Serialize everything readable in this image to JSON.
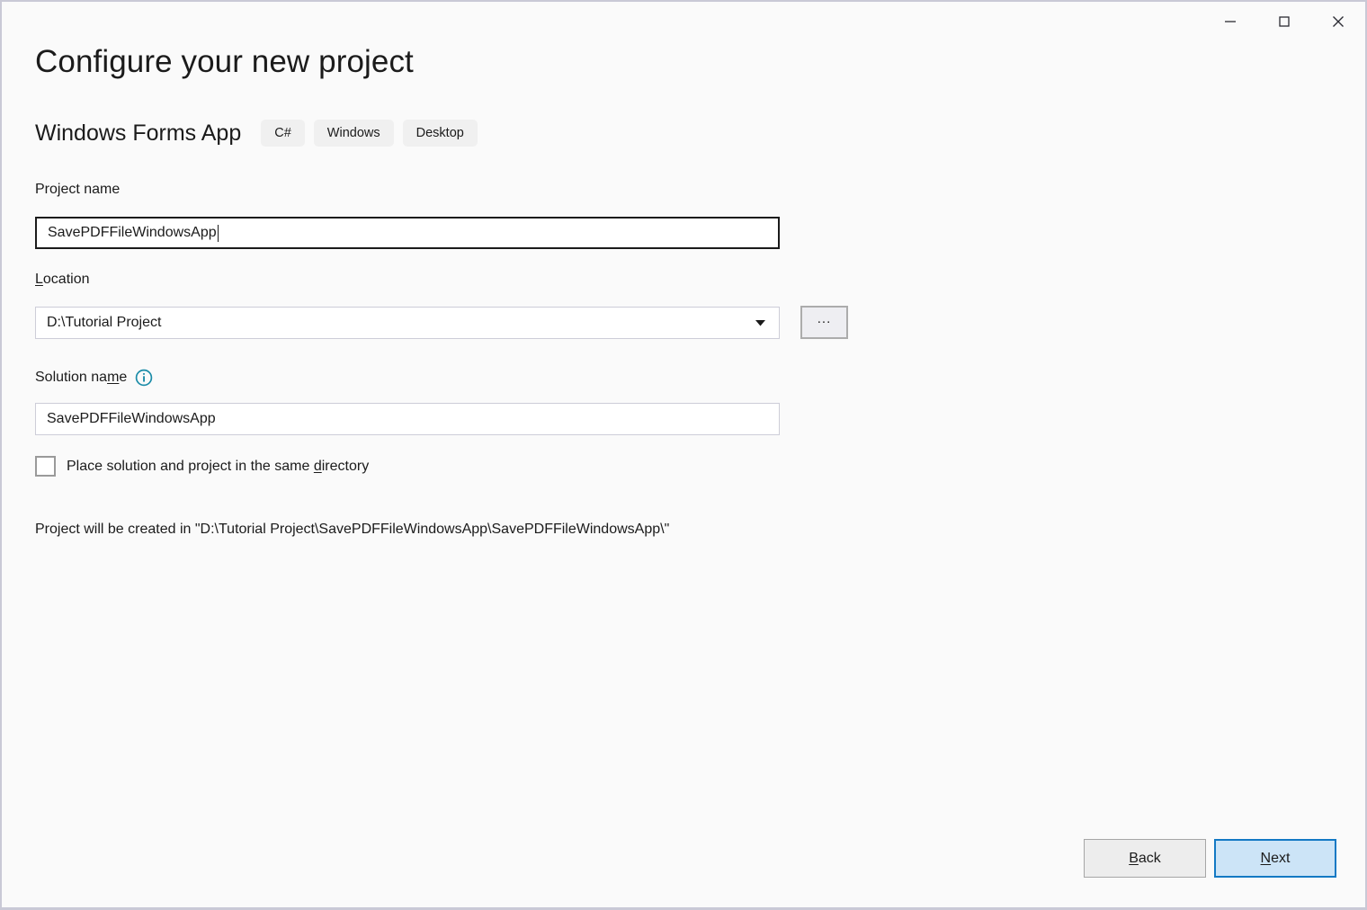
{
  "window": {
    "controls": [
      {
        "name": "minimize-button",
        "icon": "minimize-icon"
      },
      {
        "name": "maximize-button",
        "icon": "maximize-icon"
      },
      {
        "name": "close-button",
        "icon": "close-icon"
      }
    ]
  },
  "header": {
    "title": "Configure your new project",
    "template_name": "Windows Forms App",
    "tags": [
      "C#",
      "Windows",
      "Desktop"
    ]
  },
  "form": {
    "project_name": {
      "label": "Project name",
      "value": "SavePDFFileWindowsApp",
      "focused": true
    },
    "location": {
      "label_prefix": "",
      "label_accel": "L",
      "label_suffix": "ocation",
      "value": "D:\\Tutorial Project",
      "browse_label": "...",
      "dropdown_icon": "chevron-down-icon"
    },
    "solution_name": {
      "label_a": "Solution na",
      "label_accel": "m",
      "label_b": "e",
      "value": "SavePDFFileWindowsApp",
      "info_icon": "info-icon"
    },
    "same_directory_checkbox": {
      "label_a": "Place solution and project in the same ",
      "label_accel": "d",
      "label_b": "irectory",
      "checked": false
    },
    "path_note": "Project will be created in \"D:\\Tutorial Project\\SavePDFFileWindowsApp\\SavePDFFileWindowsApp\\\""
  },
  "footer": {
    "back": {
      "label_accel": "B",
      "label_suffix": "ack"
    },
    "next": {
      "label_accel": "N",
      "label_suffix": "ext",
      "is_default": true
    }
  },
  "colors": {
    "background": "#fafafa",
    "border": "#c9c9d6",
    "accent_blue": "#1379c4",
    "default_button_fill": "#cce4f7",
    "info_icon": "#1b8ca8",
    "focused_border": "#1b1b1b"
  }
}
